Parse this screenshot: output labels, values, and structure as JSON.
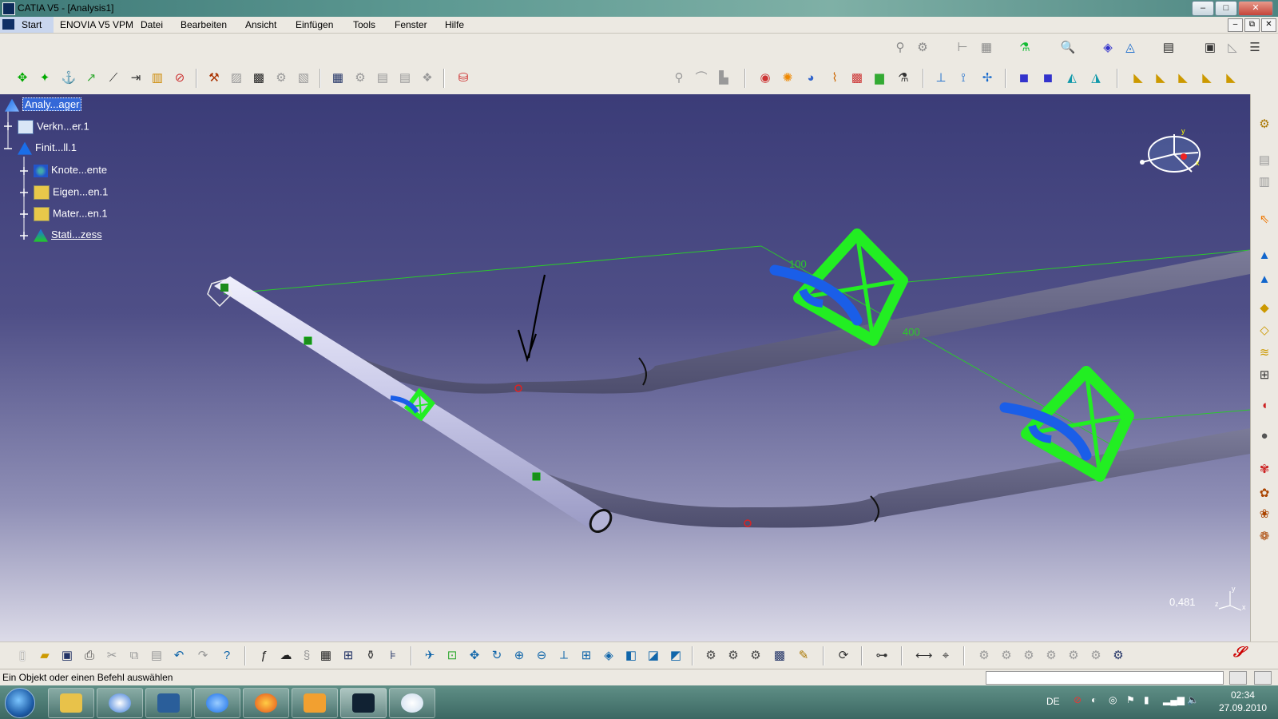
{
  "window": {
    "title": "CATIA V5 - [Analysis1]",
    "buttons": [
      "–",
      "□",
      "✕"
    ]
  },
  "menubar": {
    "start": "Start",
    "items": [
      "ENOVIA V5 VPM",
      "Datei",
      "Bearbeiten",
      "Ansicht",
      "Einfügen",
      "Tools",
      "Fenster",
      "Hilfe"
    ],
    "mdi_buttons": [
      "–",
      "⧉",
      "✕"
    ]
  },
  "tree": {
    "root": "Analy...ager",
    "nodes": [
      "Verkn...er.1",
      "Finit...ll.1",
      "Knote...ente",
      "Eigen...en.1",
      "Mater...en.1",
      "Stati...zess"
    ]
  },
  "viewport": {
    "dimension_labels": [
      "100",
      "400"
    ],
    "zoom_value": "0,481",
    "compass_axes": [
      "y",
      "x"
    ],
    "mini_axes": [
      "y",
      "z",
      "x"
    ]
  },
  "statusbar": {
    "message": "Ein Objekt oder einen Befehl auswählen",
    "command_input": ""
  },
  "taskbar": {
    "language": "DE",
    "time": "02:34",
    "date": "27.09.2010"
  },
  "colors": {
    "viewport_top": "#3b3c78",
    "viewport_bottom": "#dcdbe8",
    "pipe": "#c8c8e8",
    "load_symbol": "#22ee22",
    "restraint_symbol": "#1a5ee8",
    "selection": "#3468d8"
  }
}
